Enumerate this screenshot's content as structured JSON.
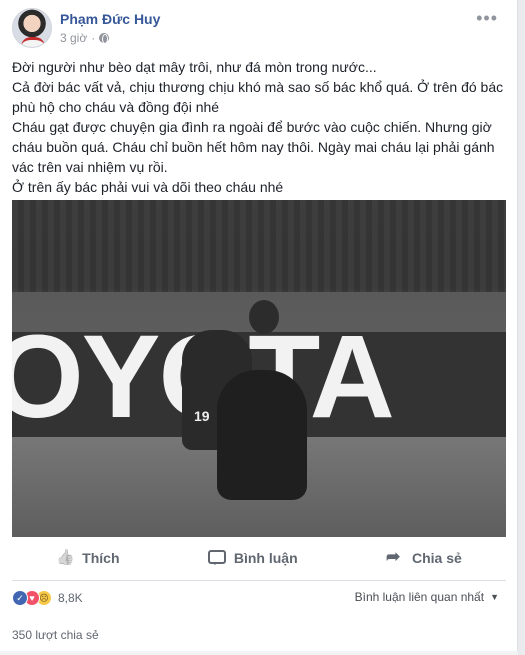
{
  "post": {
    "author": "Phạm Đức Huy",
    "time": "3 giờ",
    "separator": "·",
    "paragraphs": [
      "Đời người như bèo dạt mây trôi, như đá mòn trong nước...",
      "Cả đời bác vất vả, chịu thương chịu khó mà sao số bác khổ quá. Ở trên đó bác phù hộ cho cháu và đồng đội nhé",
      "Cháu gạt được chuyện gia đình ra ngoài để bước vào cuộc chiến. Nhưng giờ cháu buồn quá. Cháu chỉ buồn hết hôm nay thôi. Ngày mai cháu lại phải gánh vác trên vai nhiệm vụ rồi.",
      "Ở trên ấy bác phải vui và dõi theo cháu nhé"
    ],
    "photo": {
      "board_text": "OYOTA",
      "jersey_number": "19"
    }
  },
  "actions": {
    "like": "Thích",
    "comment": "Bình luận",
    "share": "Chia sẻ"
  },
  "stats": {
    "reaction_count": "8,8K",
    "sort_label": "Bình luận liên quan nhất",
    "shares": "350 lượt chia sẻ"
  },
  "colors": {
    "author_link": "#365899",
    "like_reaction": "#4267b2",
    "love_reaction": "#f25268",
    "sad_reaction": "#f7c948"
  },
  "icons": [
    "globe-icon",
    "more-options-icon",
    "like-icon",
    "comment-icon",
    "share-icon",
    "sort-caret-icon"
  ]
}
